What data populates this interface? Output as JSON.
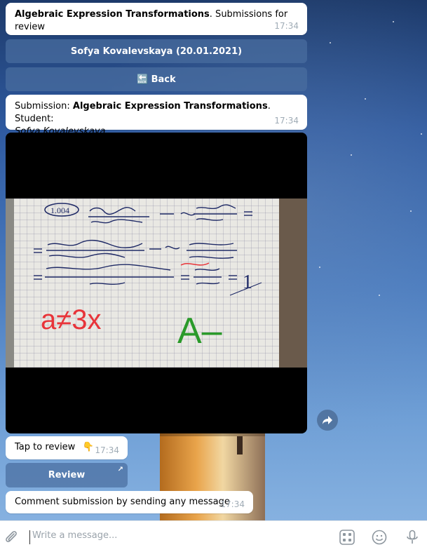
{
  "messages": {
    "header": {
      "title_bold": "Algebraic Expression Transformations",
      "title_rest": ". Submissions for review",
      "time": "17:34"
    },
    "submission": {
      "prefix": "Submission: ",
      "title_bold": "Algebraic Expression Transformations",
      "middle": ". Student:",
      "student": "Sofya Kovalevskaya",
      "time": "17:34"
    },
    "tap": {
      "text": "Tap to review",
      "emoji": "👇",
      "time": "17:34"
    },
    "comment": {
      "text": "Comment submission by sending any message",
      "time": "17:34"
    }
  },
  "buttons": {
    "student": "Sofya Kovalevskaya (20.01.2021)",
    "back_icon": "🔙",
    "back": "Back",
    "review": "Review",
    "review_corner": "↗"
  },
  "photo": {
    "annotations": {
      "red": "a≠3x",
      "green": "A–",
      "result": "1"
    },
    "label": "1.004"
  },
  "composer": {
    "placeholder": "Write a message..."
  },
  "icons": {
    "forward": "forward-icon",
    "attach": "paperclip-icon",
    "commands": "bot-commands-icon",
    "emoji": "emoji-icon",
    "mic": "microphone-icon"
  },
  "colors": {
    "button_bg": "#4a6ea0",
    "time_gray": "#a0acb6",
    "annotation_red": "#e8343a",
    "annotation_green": "#2a9a2a"
  }
}
